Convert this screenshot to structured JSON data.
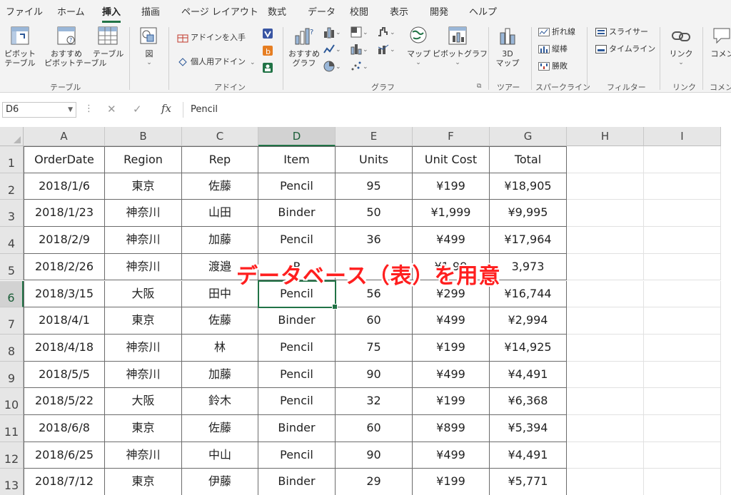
{
  "ribbon_tabs": [
    "ファイル",
    "ホーム",
    "挿入",
    "描画",
    "ページ レイアウト",
    "数式",
    "データ",
    "校閲",
    "表示",
    "開発",
    "ヘルプ"
  ],
  "active_tab": "挿入",
  "ribbon": {
    "tables": {
      "pivot": "ピボット\nテーブル",
      "recommended_pivot": "おすすめ\nピボットテーブル",
      "table": "テーブル",
      "group_label": "テーブル"
    },
    "illustrations": {
      "figure": "図"
    },
    "addins": {
      "get_addins": "アドインを入手",
      "personal_addins": "個人用アドイン",
      "group_label": "アドイン"
    },
    "charts": {
      "recommended": "おすすめ\nグラフ",
      "map": "マップ",
      "pivot_chart": "ピボットグラフ",
      "group_label": "グラフ"
    },
    "tours": {
      "map3d": "3D\nマップ",
      "group_label": "ツアー"
    },
    "sparklines": {
      "line": "折れ線",
      "column": "縦棒",
      "winloss": "勝敗",
      "group_label": "スパークライン"
    },
    "filters": {
      "slicer": "スライサー",
      "timeline": "タイムライン",
      "group_label": "フィルター"
    },
    "links": {
      "link": "リンク",
      "group_label": "リンク"
    },
    "comments": {
      "comment": "コメン",
      "group_label": "コメン"
    }
  },
  "formula_bar": {
    "name_box": "D6",
    "fx": "fx",
    "value": "Pencil"
  },
  "columns": [
    "A",
    "B",
    "C",
    "D",
    "E",
    "F",
    "G",
    "H",
    "I"
  ],
  "selected_column": "D",
  "selected_row": 6,
  "rows": [
    {
      "n": "1",
      "cells": [
        "OrderDate",
        "Region",
        "Rep",
        "Item",
        "Units",
        "Unit Cost",
        "Total"
      ]
    },
    {
      "n": "2",
      "cells": [
        "2018/1/6",
        "東京",
        "佐藤",
        "Pencil",
        "95",
        "¥199",
        "¥18,905"
      ]
    },
    {
      "n": "3",
      "cells": [
        "2018/1/23",
        "神奈川",
        "山田",
        "Binder",
        "50",
        "¥1,999",
        "¥9,995"
      ]
    },
    {
      "n": "4",
      "cells": [
        "2018/2/9",
        "神奈川",
        "加藤",
        "Pencil",
        "36",
        "¥499",
        "¥17,964"
      ]
    },
    {
      "n": "5",
      "cells": [
        "2018/2/26",
        "神奈川",
        "渡邉",
        "P",
        "",
        "¥1,99",
        "3,973"
      ]
    },
    {
      "n": "6",
      "cells": [
        "2018/3/15",
        "大阪",
        "田中",
        "Pencil",
        "56",
        "¥299",
        "¥16,744"
      ]
    },
    {
      "n": "7",
      "cells": [
        "2018/4/1",
        "東京",
        "佐藤",
        "Binder",
        "60",
        "¥499",
        "¥2,994"
      ]
    },
    {
      "n": "8",
      "cells": [
        "2018/4/18",
        "神奈川",
        "林",
        "Pencil",
        "75",
        "¥199",
        "¥14,925"
      ]
    },
    {
      "n": "9",
      "cells": [
        "2018/5/5",
        "神奈川",
        "加藤",
        "Pencil",
        "90",
        "¥499",
        "¥4,491"
      ]
    },
    {
      "n": "10",
      "cells": [
        "2018/5/22",
        "大阪",
        "鈴木",
        "Pencil",
        "32",
        "¥199",
        "¥6,368"
      ]
    },
    {
      "n": "11",
      "cells": [
        "2018/6/8",
        "東京",
        "佐藤",
        "Binder",
        "60",
        "¥899",
        "¥5,394"
      ]
    },
    {
      "n": "12",
      "cells": [
        "2018/6/25",
        "神奈川",
        "中山",
        "Pencil",
        "90",
        "¥499",
        "¥4,491"
      ]
    },
    {
      "n": "13",
      "cells": [
        "2018/7/12",
        "東京",
        "伊藤",
        "Binder",
        "29",
        "¥199",
        "¥5,771"
      ]
    }
  ],
  "overlay": "データベース（表）を用意",
  "colors": {
    "accent": "#217346",
    "overlay": "#ff1f1f"
  }
}
